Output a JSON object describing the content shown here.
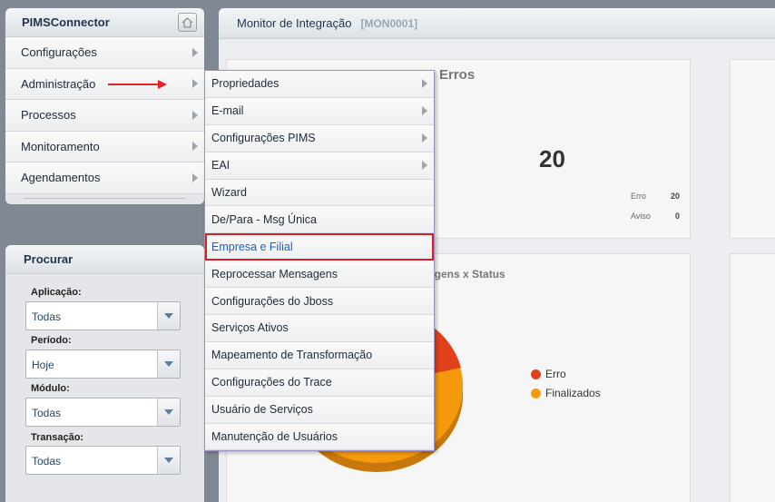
{
  "nav": {
    "title": "PIMSConnector",
    "items": [
      {
        "label": "Configurações"
      },
      {
        "label": "Administração"
      },
      {
        "label": "Processos"
      },
      {
        "label": "Monitoramento"
      },
      {
        "label": "Agendamentos"
      }
    ]
  },
  "search": {
    "title": "Procurar",
    "fields": [
      {
        "label": "Aplicação:",
        "value": "Todas"
      },
      {
        "label": "Período:",
        "value": "Hoje"
      },
      {
        "label": "Módulo:",
        "value": "Todas"
      },
      {
        "label": "Transação:",
        "value": "Todas"
      }
    ]
  },
  "main": {
    "title": "Monitor de Integração",
    "code": "[MON0001]",
    "errors_card": {
      "title": "Erros",
      "total": "20",
      "rows": [
        {
          "label": "Erro",
          "value": "20"
        },
        {
          "label": "Aviso",
          "value": "0"
        }
      ]
    },
    "chart_card": {
      "title": "agens x Status",
      "legend": [
        {
          "name": "Erro",
          "color": "#e0411a"
        },
        {
          "name": "Finalizados",
          "color": "#f59a0c"
        }
      ]
    }
  },
  "submenu": {
    "items": [
      {
        "label": "Propriedades"
      },
      {
        "label": "E-mail"
      },
      {
        "label": "Configurações PIMS"
      },
      {
        "label": "EAI"
      },
      {
        "label": "Wizard"
      },
      {
        "label": "De/Para - Msg Única"
      },
      {
        "label": "Empresa e Filial"
      },
      {
        "label": "Reprocessar Mensagens"
      },
      {
        "label": "Configurações do Jboss"
      },
      {
        "label": "Serviços Ativos"
      },
      {
        "label": "Mapeamento de Transformação"
      },
      {
        "label": "Configurações do Trace"
      },
      {
        "label": "Usuário de Serviços"
      },
      {
        "label": "Manutenção de Usuários"
      }
    ]
  },
  "colors": {
    "highlight_border": "#d61f26",
    "arrow": "#e32222"
  }
}
